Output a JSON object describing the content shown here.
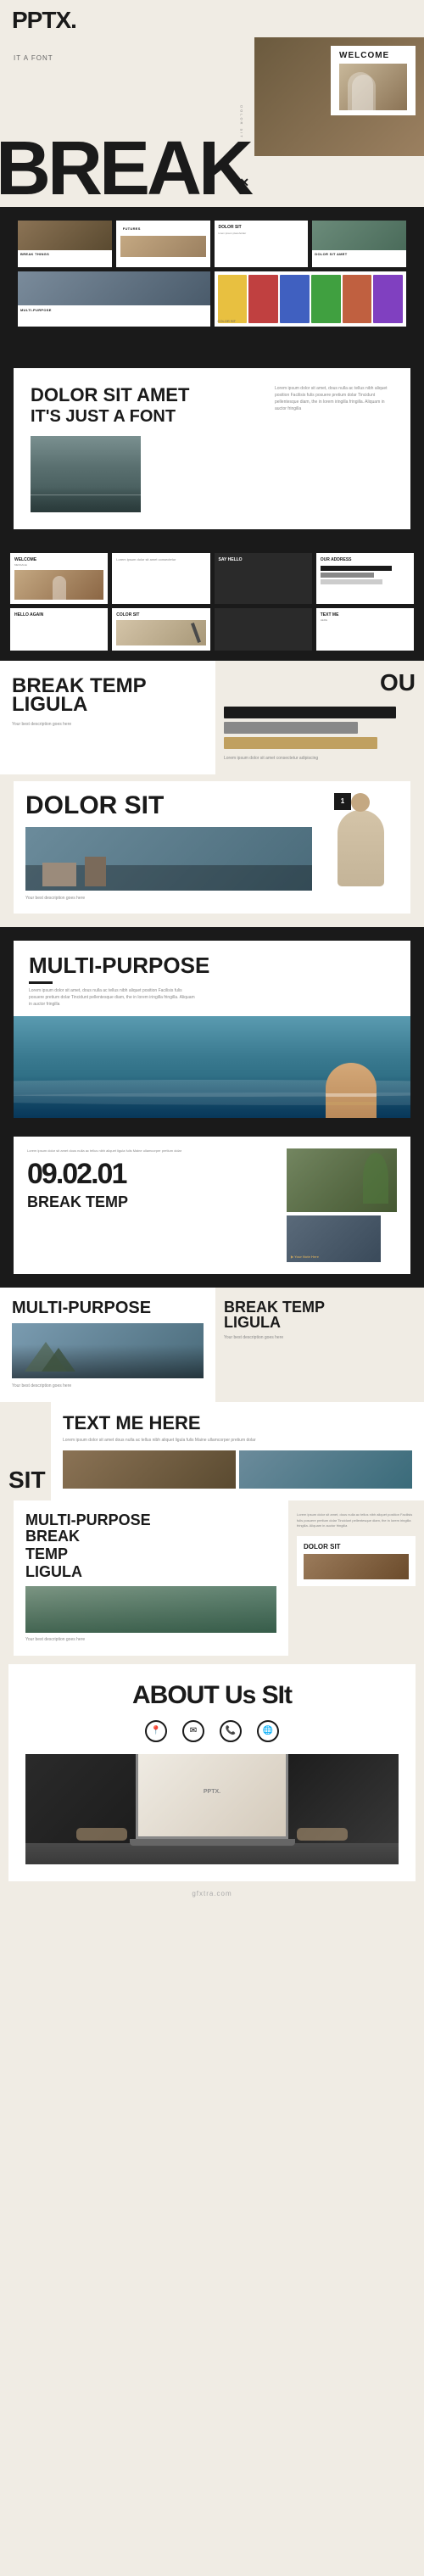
{
  "site": {
    "name": "PPTX.",
    "url": "gfxtra.com",
    "watermark": "gfxtra.com"
  },
  "header": {
    "logo": "PPTX.",
    "tagline": "IT A FONT",
    "hero_text": "BREAK",
    "welcome_label": "WELCOME"
  },
  "slides": {
    "slide1_labels": [
      "BREAK THINGS",
      "FUTURES",
      "DOLOR SIT",
      "DOLOR SIT AMET",
      "MULTI-PURPOSE"
    ],
    "dolor_title": "DOLOR SIT AMET",
    "dolor_subtitle": "IT'S JUST A FONT",
    "welcome_label": "WELCOME",
    "our_address": "OUR ADDRESS",
    "say_hello": "SAY HELLO",
    "hello_again": "HELLO AGAIN",
    "color_sit": "COLOR SIT",
    "text_me": "TEXT ME HERE",
    "break_temp": "BREAK TEMP",
    "ligula": "LIGULA",
    "dolor_sit": "DOLOR SIT",
    "multi_purpose": "MULTI-PURPOSE",
    "about_us": "ABOUT Us SIt",
    "date_display": "09.02.01",
    "lorem_body": "Lorem ipsum dolor sit amet, dous nulla ac tellus nibh aliquet position Facilisis fulis posuere pretium dolar Tincidunt pellentesque diam, the in lorem iringilla fringilla. Aliquam in auctor fringilla",
    "lorem_short": "Lorem ipsum dolor sit amet dous nulla ac tellus nibh aliquet ligula fulis Maine ullamcorper pretium dolar",
    "your_note": "Your Note Here",
    "description": "Your best description goes here"
  },
  "icons": {
    "location": "📍",
    "mail": "✉",
    "phone": "📞",
    "globe": "🌐"
  },
  "colors": {
    "dark": "#1a1a1a",
    "light_bg": "#f0ece4",
    "white": "#ffffff",
    "brown": "#8b7355",
    "accent_red": "#c0392b",
    "accent_gold": "#c0a060"
  }
}
